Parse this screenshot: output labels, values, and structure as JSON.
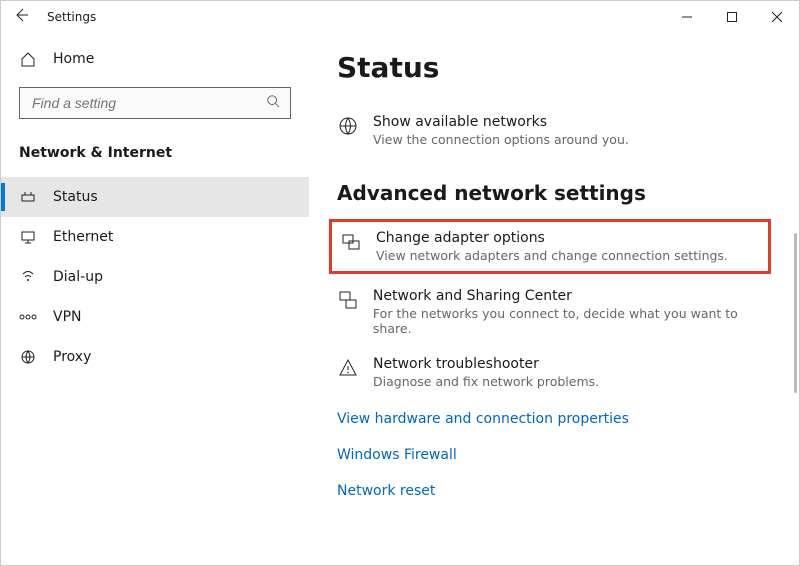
{
  "window": {
    "title": "Settings"
  },
  "sidebar": {
    "home": "Home",
    "search_placeholder": "Find a setting",
    "category": "Network & Internet",
    "items": [
      {
        "icon": "status-icon",
        "label": "Status"
      },
      {
        "icon": "ethernet-icon",
        "label": "Ethernet"
      },
      {
        "icon": "dialup-icon",
        "label": "Dial-up"
      },
      {
        "icon": "vpn-icon",
        "label": "VPN"
      },
      {
        "icon": "proxy-icon",
        "label": "Proxy"
      }
    ]
  },
  "main": {
    "heading": "Status",
    "available": {
      "title": "Show available networks",
      "desc": "View the connection options around you."
    },
    "advanced_heading": "Advanced network settings",
    "adapter": {
      "title": "Change adapter options",
      "desc": "View network adapters and change connection settings."
    },
    "sharing": {
      "title": "Network and Sharing Center",
      "desc": "For the networks you connect to, decide what you want to share."
    },
    "troubleshooter": {
      "title": "Network troubleshooter",
      "desc": "Diagnose and fix network problems."
    },
    "links": {
      "hardware": "View hardware and connection properties",
      "firewall": "Windows Firewall",
      "reset": "Network reset"
    }
  }
}
